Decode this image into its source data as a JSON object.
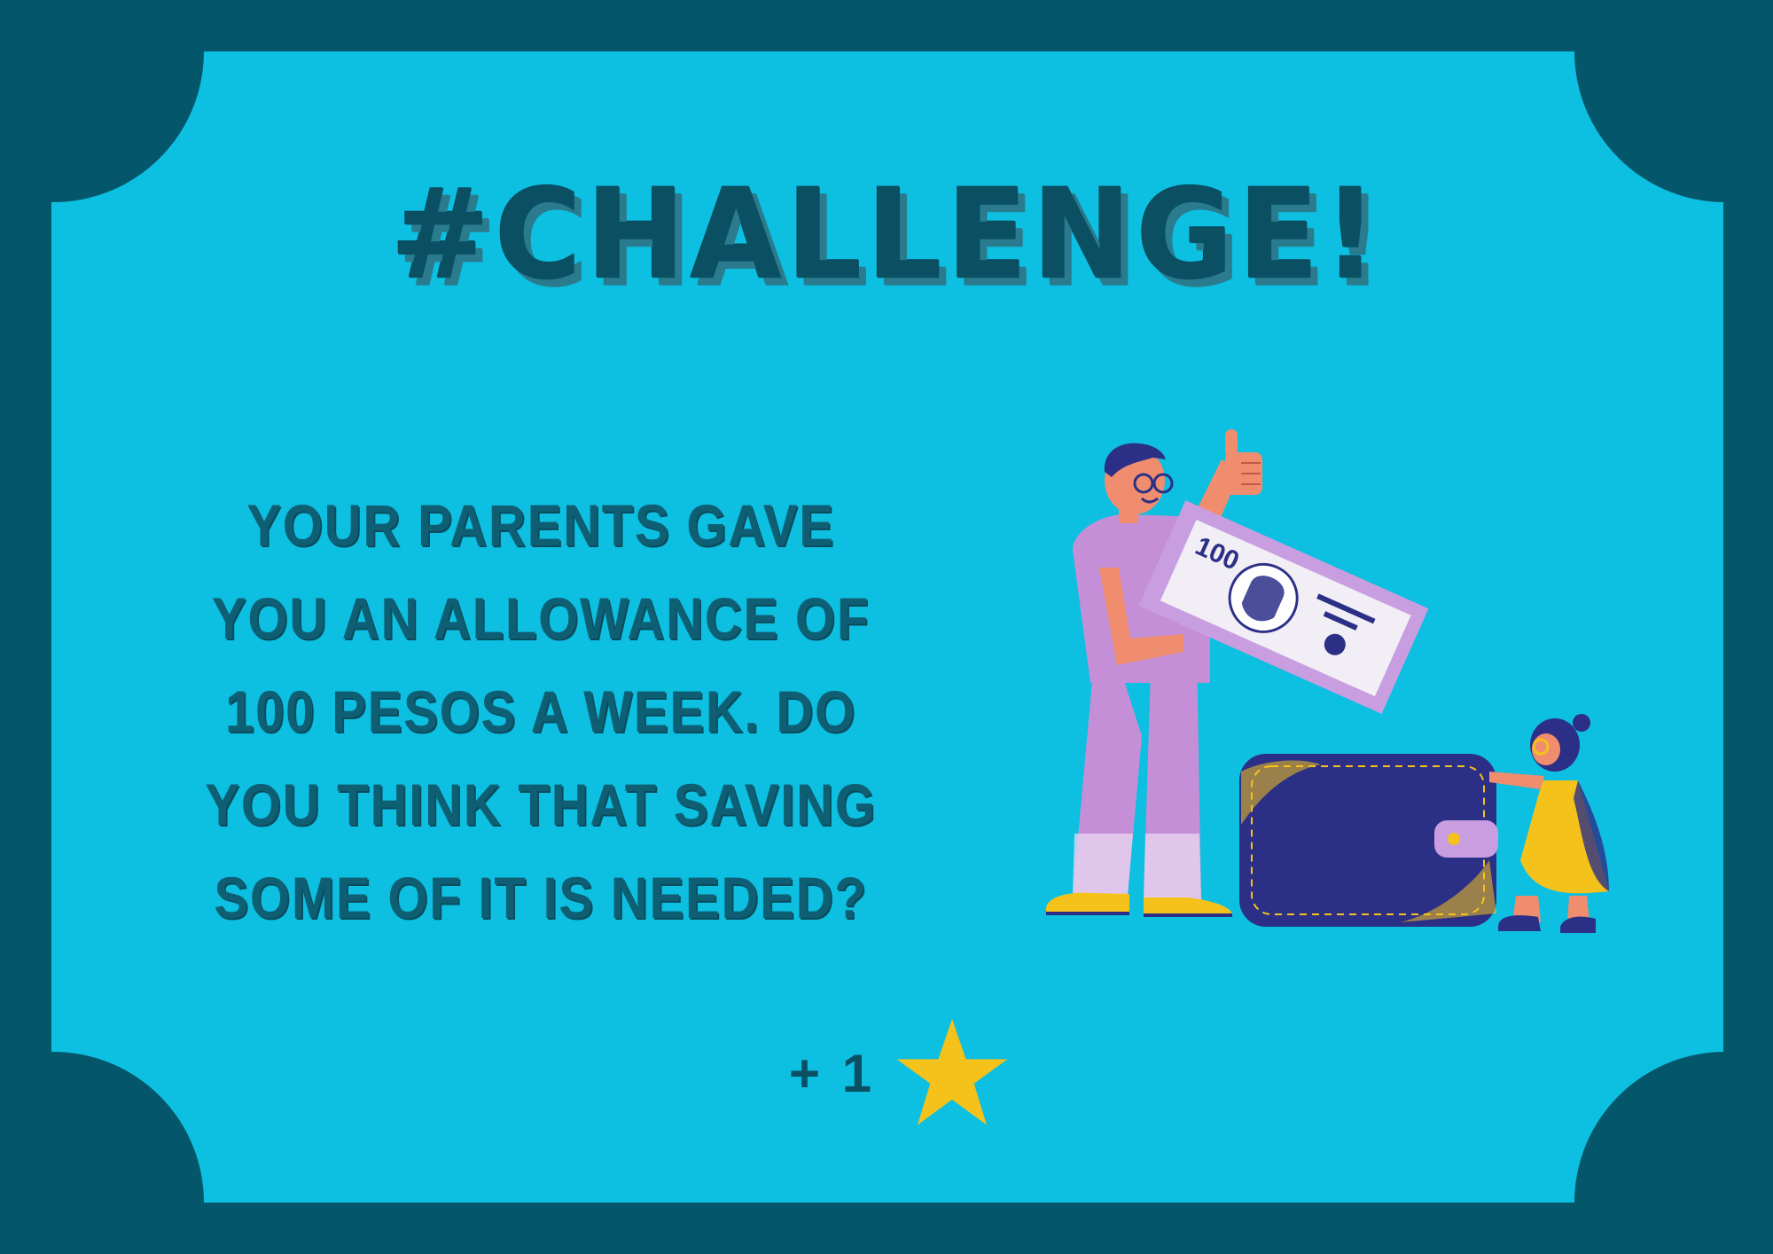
{
  "card": {
    "title": "#CHALLENGE!",
    "question": "YOUR PARENTS GAVE YOU AN ALLOWANCE OF 100 PESOS A WEEK. DO YOU THINK THAT SAVING SOME OF IT IS NEEDED?",
    "reward_text": "+ 1",
    "reward_icon": "star-icon",
    "banknote_text": "100"
  },
  "colors": {
    "frame": "#04566b",
    "card": "#0dbfe0",
    "title": "#0b4f63",
    "star": "#f5c21b",
    "wallet": "#2c2f86",
    "bill": "#c89ee0",
    "adult_outfit": "#c48fd6",
    "child_dress": "#f5c21b",
    "skin": "#f08d6e"
  },
  "illustration": {
    "icons": [
      "man-figure-icon",
      "child-figure-icon",
      "wallet-icon",
      "banknote-icon"
    ]
  }
}
